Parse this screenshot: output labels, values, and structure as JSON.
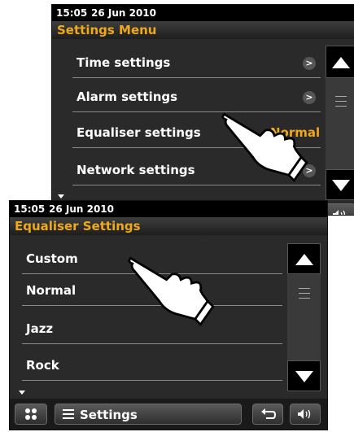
{
  "back_screen": {
    "status": {
      "time": "15:05",
      "date": "26 Jun 2010"
    },
    "title": "Settings Menu",
    "items": [
      {
        "label": "Time settings",
        "trailing": ">"
      },
      {
        "label": "Alarm settings",
        "trailing": ">"
      },
      {
        "label": "Equaliser settings",
        "value": "Normal"
      },
      {
        "label": "Network settings",
        "trailing": ">"
      }
    ]
  },
  "front_screen": {
    "status": {
      "time": "15:05",
      "date": "26 Jun 2010"
    },
    "title": "Equaliser Settings",
    "items": [
      {
        "label": "Custom"
      },
      {
        "label": "Normal"
      },
      {
        "label": "Jazz"
      },
      {
        "label": "Rock"
      }
    ],
    "bottom_bar": {
      "settings_label": "Settings"
    }
  },
  "icons": {
    "scroll_up": "triangle-up-icon",
    "scroll_down": "triangle-down-icon",
    "scroll_grip": "grip-lines-icon",
    "home": "four-dots-icon",
    "menu": "hamburger-icon",
    "back": "return-arrow-icon",
    "volume": "speaker-icon",
    "pointer": "pointing-hand-icon"
  },
  "colors": {
    "accent": "#f0a81c",
    "screen_bg": "#2a2a2a",
    "status_bg": "#000000"
  }
}
